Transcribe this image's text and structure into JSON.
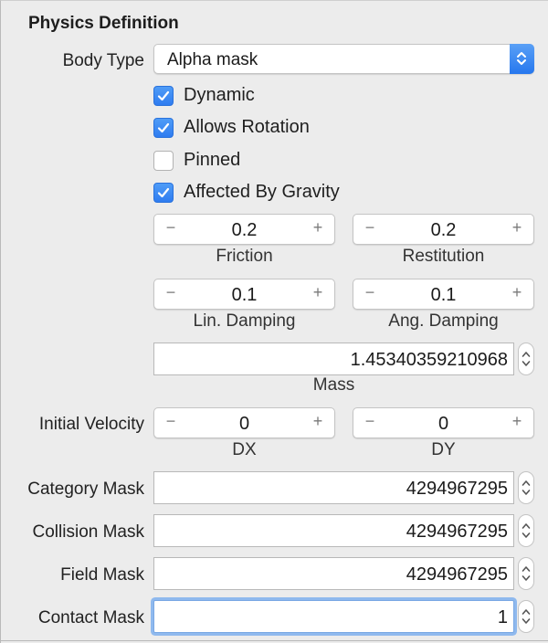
{
  "section": {
    "title": "Physics Definition"
  },
  "body_type": {
    "label": "Body Type",
    "selected": "Alpha mask"
  },
  "checkboxes": [
    {
      "label": "Dynamic",
      "checked": true
    },
    {
      "label": "Allows Rotation",
      "checked": true
    },
    {
      "label": "Pinned",
      "checked": false
    },
    {
      "label": "Affected By Gravity",
      "checked": true
    }
  ],
  "steppers": {
    "minus": "−",
    "plus": "+",
    "friction": {
      "value": "0.2",
      "caption": "Friction"
    },
    "restitution": {
      "value": "0.2",
      "caption": "Restitution"
    },
    "lin_damping": {
      "value": "0.1",
      "caption": "Lin. Damping"
    },
    "ang_damping": {
      "value": "0.1",
      "caption": "Ang. Damping"
    }
  },
  "mass": {
    "value": "1.45340359210968",
    "caption": "Mass"
  },
  "initial_velocity": {
    "label": "Initial Velocity",
    "dx": {
      "value": "0",
      "caption": "DX"
    },
    "dy": {
      "value": "0",
      "caption": "DY"
    }
  },
  "masks": {
    "category": {
      "label": "Category Mask",
      "value": "4294967295"
    },
    "collision": {
      "label": "Collision Mask",
      "value": "4294967295"
    },
    "field": {
      "label": "Field Mask",
      "value": "4294967295"
    },
    "contact": {
      "label": "Contact Mask",
      "value": "1"
    }
  },
  "colors": {
    "accent": "#2f7cf0",
    "focus_ring": "#8fb9ee",
    "panel_bg": "#ececec"
  },
  "icons": {
    "popup": "chevron-up-down-icon",
    "check": "checkmark-icon",
    "field_stepper": "chevron-up-down-icon"
  }
}
